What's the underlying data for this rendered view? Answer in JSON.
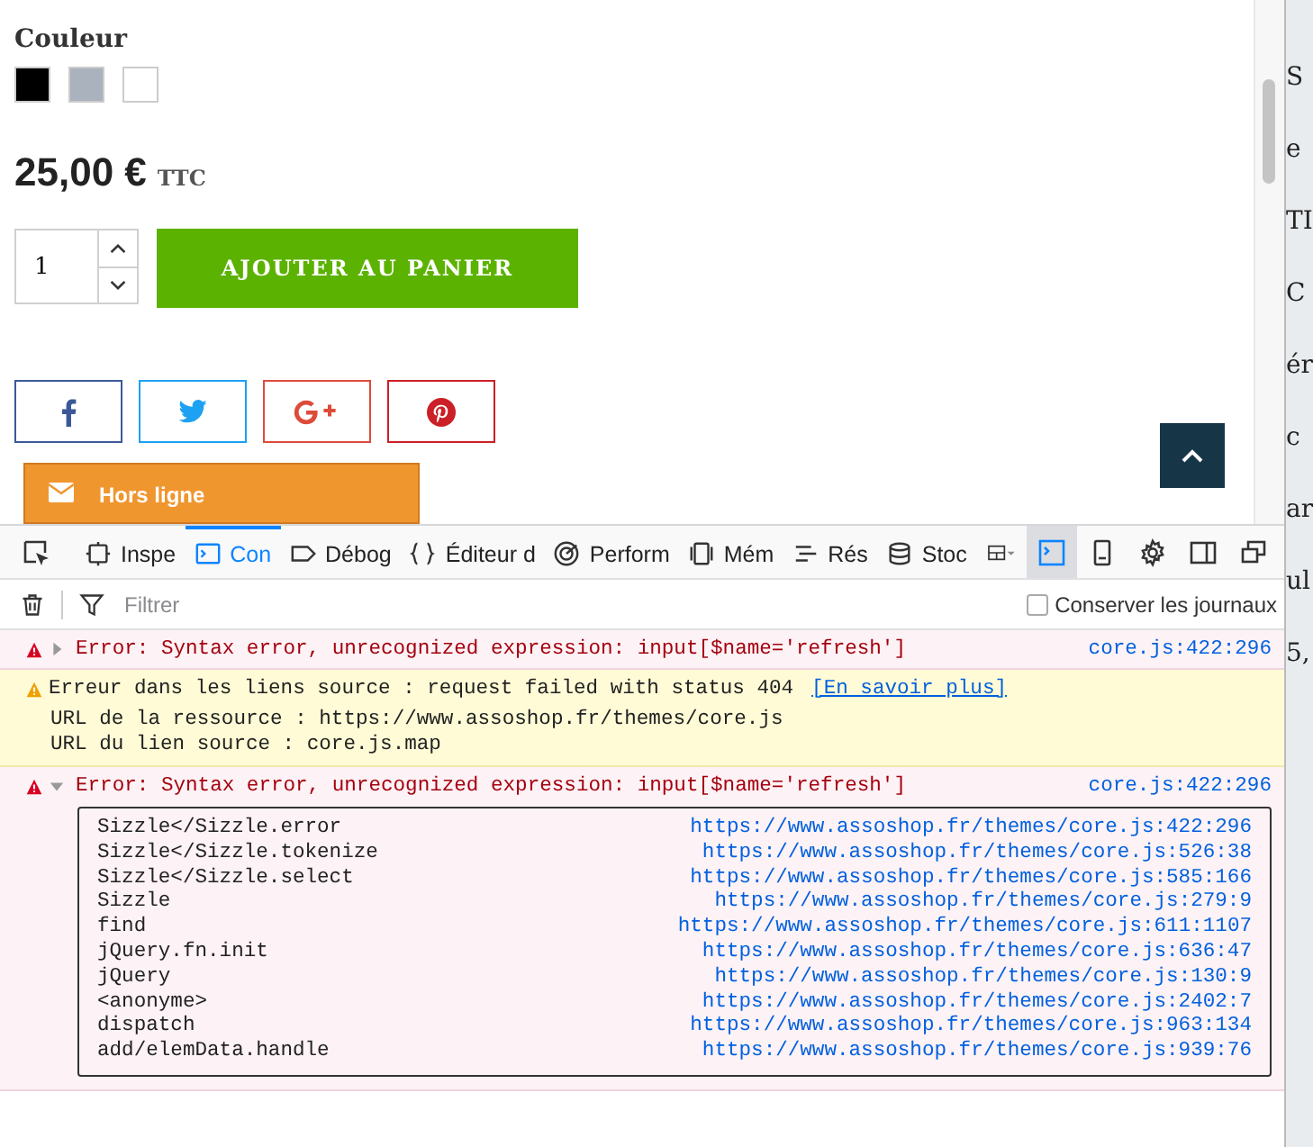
{
  "product": {
    "color_label": "Couleur",
    "swatches": [
      {
        "color": "#000000"
      },
      {
        "color": "#aab2bd"
      },
      {
        "color": "#ffffff"
      }
    ],
    "price": "25,00 €",
    "price_suffix": "TTC",
    "quantity": "1",
    "add_button": "AJOUTER AU PANIER",
    "share_buttons": [
      {
        "kind": "facebook"
      },
      {
        "kind": "twitter"
      },
      {
        "kind": "googleplus"
      },
      {
        "kind": "pinterest"
      }
    ],
    "chat": "Hors ligne"
  },
  "devtools": {
    "tabs": [
      {
        "label": "Inspe",
        "kind": "inspector",
        "selected": false
      },
      {
        "label": "Con",
        "kind": "console",
        "selected": true
      },
      {
        "label": "Débog",
        "kind": "debugger",
        "selected": false
      },
      {
        "label": "Éditeur d",
        "kind": "editor",
        "selected": false
      },
      {
        "label": "Perform",
        "kind": "performance",
        "selected": false
      },
      {
        "label": "Mém",
        "kind": "memory",
        "selected": false
      },
      {
        "label": "Rés",
        "kind": "network",
        "selected": false
      },
      {
        "label": "Stoc",
        "kind": "storage",
        "selected": false
      }
    ],
    "filter": {
      "placeholder": "Filtrer"
    },
    "preserve_logs": {
      "label": "Conserver les journaux",
      "checked": false
    },
    "messages": [
      {
        "kind": "error",
        "expanded": false,
        "text": "Error: Syntax error, unrecognized expression: input[$name='refresh']",
        "location": "core.js:422:296"
      },
      {
        "kind": "warning",
        "text": "Erreur dans les liens source : request failed with status 404",
        "link": "[En savoir plus]",
        "lines": [
          "URL de la ressource : https://www.assoshop.fr/themes/core.js",
          "URL du lien source : core.js.map"
        ]
      },
      {
        "kind": "error",
        "expanded": true,
        "text": "Error: Syntax error, unrecognized expression: input[$name='refresh']",
        "location": "core.js:422:296",
        "stack": [
          {
            "fn": "Sizzle</Sizzle.error",
            "url": "https://www.assoshop.fr/themes/core.js:422:296"
          },
          {
            "fn": "Sizzle</Sizzle.tokenize",
            "url": "https://www.assoshop.fr/themes/core.js:526:38"
          },
          {
            "fn": "Sizzle</Sizzle.select",
            "url": "https://www.assoshop.fr/themes/core.js:585:166"
          },
          {
            "fn": "Sizzle",
            "url": "https://www.assoshop.fr/themes/core.js:279:9"
          },
          {
            "fn": "find",
            "url": "https://www.assoshop.fr/themes/core.js:611:1107"
          },
          {
            "fn": "jQuery.fn.init",
            "url": "https://www.assoshop.fr/themes/core.js:636:47"
          },
          {
            "fn": "jQuery",
            "url": "https://www.assoshop.fr/themes/core.js:130:9"
          },
          {
            "fn": "<anonyme>",
            "url": "https://www.assoshop.fr/themes/core.js:2402:7"
          },
          {
            "fn": "dispatch",
            "url": "https://www.assoshop.fr/themes/core.js:963:134"
          },
          {
            "fn": "add/elemData.handle",
            "url": "https://www.assoshop.fr/themes/core.js:939:76"
          }
        ]
      }
    ]
  },
  "background_window": {
    "fragments": [
      "S",
      "e",
      "TI",
      "C",
      "ér",
      "c",
      "ar",
      "ul",
      "5,"
    ]
  }
}
